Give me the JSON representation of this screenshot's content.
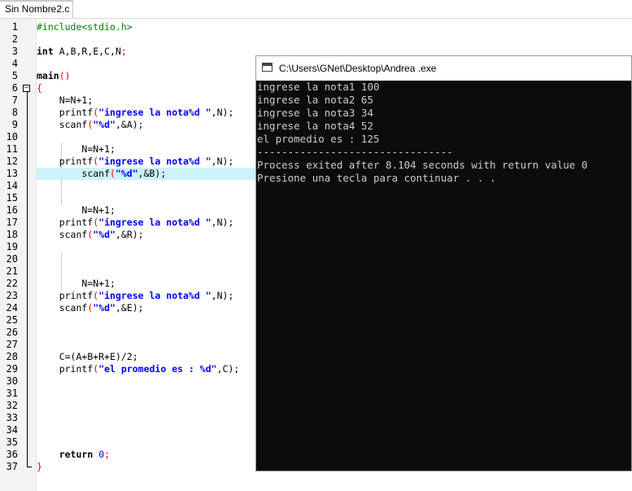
{
  "tab": {
    "label": "Sin Nombre2.c"
  },
  "gutter": {
    "lines": [
      "1",
      "2",
      "3",
      "4",
      "5",
      "6",
      "7",
      "8",
      "9",
      "10",
      "11",
      "12",
      "13",
      "14",
      "15",
      "16",
      "17",
      "18",
      "19",
      "20",
      "21",
      "22",
      "23",
      "24",
      "25",
      "26",
      "27",
      "28",
      "29",
      "30",
      "31",
      "32",
      "33",
      "34",
      "35",
      "36",
      "37"
    ]
  },
  "code": {
    "line1": {
      "text": "#include<stdio.h>"
    },
    "line3": {
      "kw": "int",
      "vars": "A,B,R,E,C,N",
      "end": ";"
    },
    "line5": {
      "name": "main",
      "parens": "()"
    },
    "line6": {
      "brace": "{"
    },
    "line7": {
      "text": "N=N+1;"
    },
    "line8": {
      "fn": "printf",
      "str": "\"ingrese la nota%d \"",
      "args": ",N);"
    },
    "line9": {
      "fn": "scanf",
      "str": "\"%d\"",
      "args": ",&A);"
    },
    "line11": {
      "text": "N=N+1;"
    },
    "line12": {
      "fn": "printf",
      "str": "\"ingrese la nota%d \"",
      "args": ",N);"
    },
    "line13": {
      "fn": "scanf",
      "str": "\"%d\"",
      "args": ",&B);"
    },
    "line16": {
      "text": "N=N+1;"
    },
    "line17": {
      "fn": "printf",
      "str": "\"ingrese la nota%d \"",
      "args": ",N);"
    },
    "line18": {
      "fn": "scanf",
      "str": "\"%d\"",
      "args": ",&R);"
    },
    "line22": {
      "text": "N=N+1;"
    },
    "line23": {
      "fn": "printf",
      "str": "\"ingrese la nota%d \"",
      "args": ",N);"
    },
    "line24": {
      "fn": "scanf",
      "str": "\"%d\"",
      "args": ",&E);"
    },
    "line28": {
      "text": "C=(A+B+R+E)/2;"
    },
    "line29": {
      "fn": "printf",
      "str": "\"el promedio es : %d\"",
      "args": ",C);"
    },
    "line36": {
      "kw": "return",
      "val": "0",
      "end": ";"
    },
    "line37": {
      "brace": "}"
    }
  },
  "console": {
    "title": "C:\\Users\\GNet\\Desktop\\Andrea .exe",
    "lines": [
      "ingrese la nota1 100",
      "ingrese la nota2 65",
      "ingrese la nota3 34",
      "ingrese la nota4 52",
      "el promedio es : 125",
      "--------------------------------",
      "Process exited after 8.104 seconds with return value 0",
      "Presione una tecla para continuar . . ."
    ]
  },
  "colors": {
    "highlight_line": "#ccf2fa",
    "string": "#0000ff",
    "preprocessor": "#008000",
    "operator": "#ff0000",
    "console_bg": "#0c0c0c",
    "console_fg": "#cccccc"
  }
}
